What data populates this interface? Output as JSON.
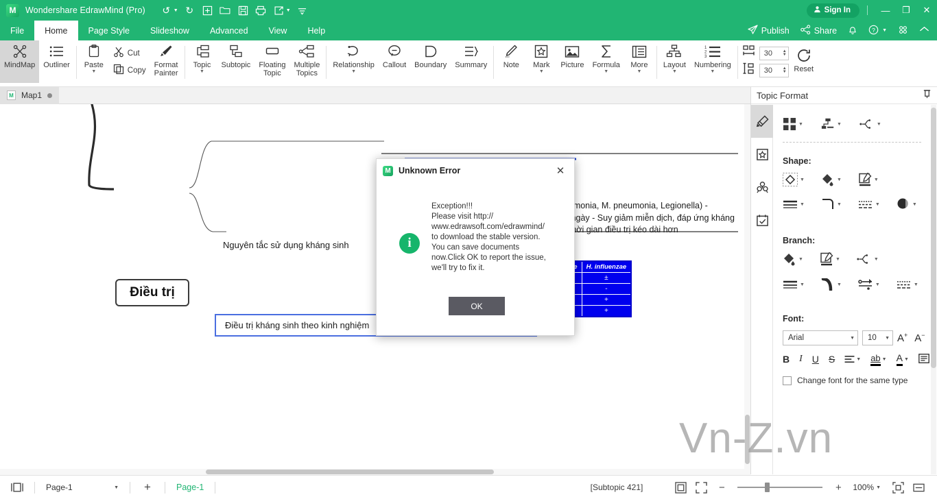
{
  "titlebar": {
    "app_name": "Wondershare EdrawMind (Pro)",
    "logo_glyph": "M",
    "quick_access": [
      {
        "name": "undo-icon",
        "glyph": "↺",
        "caret": true
      },
      {
        "name": "redo-icon",
        "glyph": "↻",
        "caret": false
      },
      {
        "name": "new-icon",
        "glyph": "⊞",
        "caret": false
      },
      {
        "name": "open-icon",
        "glyph": "🗀",
        "caret": false
      },
      {
        "name": "save-icon",
        "glyph": "🖫",
        "caret": false
      },
      {
        "name": "print-icon",
        "glyph": "⎙",
        "caret": false
      },
      {
        "name": "export-icon",
        "glyph": "⇱",
        "caret": true
      },
      {
        "name": "more-qat-icon",
        "glyph": "⩲",
        "caret": false
      }
    ],
    "sign_in": "Sign In",
    "minimize": "—",
    "restore": "❐",
    "close": "✕"
  },
  "menubar": {
    "items": [
      {
        "label": "File",
        "active": false
      },
      {
        "label": "Home",
        "active": true
      },
      {
        "label": "Page Style",
        "active": false
      },
      {
        "label": "Slideshow",
        "active": false
      },
      {
        "label": "Advanced",
        "active": false
      },
      {
        "label": "View",
        "active": false
      },
      {
        "label": "Help",
        "active": false
      }
    ],
    "right": [
      {
        "label": "Publish",
        "icon": "publish-icon"
      },
      {
        "label": "Share",
        "icon": "share-icon"
      },
      {
        "label": "",
        "icon": "bell-icon"
      },
      {
        "label": "",
        "icon": "help-icon"
      },
      {
        "label": "",
        "icon": "apps-grid-icon"
      },
      {
        "label": "",
        "icon": "collapse-ribbon-icon"
      }
    ]
  },
  "ribbon": {
    "view_group": [
      {
        "label": "MindMap",
        "icon": "mindmap-icon",
        "selected": true
      },
      {
        "label": "Outliner",
        "icon": "outliner-icon",
        "selected": false
      }
    ],
    "clipboard": {
      "paste_label": "Paste",
      "cut_label": "Cut",
      "copy_label": "Copy",
      "format_painter_label": "Format\nPainter"
    },
    "insert_group": [
      {
        "label": "Topic",
        "icon": "topic-icon",
        "dropdown": true
      },
      {
        "label": "Subtopic",
        "icon": "subtopic-icon",
        "dropdown": false
      },
      {
        "label": "Floating\nTopic",
        "icon": "floating-topic-icon",
        "dropdown": false
      },
      {
        "label": "Multiple\nTopics",
        "icon": "multiple-topics-icon",
        "dropdown": false
      }
    ],
    "relation_group": [
      {
        "label": "Relationship",
        "icon": "relationship-icon",
        "dropdown": true
      },
      {
        "label": "Callout",
        "icon": "callout-icon",
        "dropdown": false
      },
      {
        "label": "Boundary",
        "icon": "boundary-icon",
        "dropdown": false
      },
      {
        "label": "Summary",
        "icon": "summary-icon",
        "dropdown": false
      }
    ],
    "annotate_group": [
      {
        "label": "Note",
        "icon": "note-icon",
        "dropdown": false
      },
      {
        "label": "Mark",
        "icon": "mark-icon",
        "dropdown": true
      },
      {
        "label": "Picture",
        "icon": "picture-icon",
        "dropdown": false
      },
      {
        "label": "Formula",
        "icon": "formula-icon",
        "dropdown": true
      },
      {
        "label": "More",
        "icon": "more-icon",
        "dropdown": true
      }
    ],
    "layout_group": [
      {
        "label": "Layout",
        "icon": "layout-icon",
        "dropdown": true
      },
      {
        "label": "Numbering",
        "icon": "numbering-icon",
        "dropdown": true
      }
    ],
    "spacing": {
      "horizontal_value": "30",
      "vertical_value": "30",
      "reset_label": "Reset"
    }
  },
  "doc_tabs": {
    "tabs": [
      {
        "label": "Map1",
        "modified": true
      }
    ]
  },
  "canvas": {
    "root_topic": "Điều trị",
    "topic_principles": "Nguyên tắc sử dụng kháng sinh",
    "topic_selected": "Điều trị kháng sinh theo kinh nghiệm",
    "note_text": "- Tác nhân không điển hình: 10 - 14 ngày (C. pneumonia, M. pneumonia, Legionella)\n- S.pneumonia kháng thuốc hay Pseudomonas: 15 ngày\n- Suy giảm miễn dịch, đáp ứng kháng sinh không hoàn toàn, có biến chứng ngoài phổi: thời gian điều trị kéo dài hơn",
    "table": {
      "headers": [
        "S. pneumoniae",
        "H. influenzae"
      ],
      "rows": [
        [
          "±",
          "±"
        ],
        [
          "±",
          "-"
        ],
        [
          "±",
          "+"
        ],
        [
          "+",
          "+"
        ]
      ]
    },
    "watermark": "Vn-Z.vn"
  },
  "dialog": {
    "title": "Unknown Error",
    "close_glyph": "✕",
    "info_glyph": "i",
    "message": "Exception!!!\nPlease visit http://\nwww.edrawsoft.com/edrawmind/\nto download the stable version.\nYou can save documents\nnow.Click OK to report the issue,\nwe'll try to fix it.",
    "ok_label": "OK"
  },
  "right_panel": {
    "title": "Topic Format",
    "pin_icon": "pin-icon",
    "rail": [
      {
        "name": "style-fill-icon",
        "selected": true
      },
      {
        "name": "badge-icon",
        "selected": false
      },
      {
        "name": "clipart-icon",
        "selected": false
      },
      {
        "name": "task-icon",
        "selected": false
      }
    ],
    "top_icons": [
      {
        "name": "topic-style-gallery-icon"
      },
      {
        "name": "topic-layout-icon"
      },
      {
        "name": "branch-style-icon"
      }
    ],
    "shape_section_label": "Shape:",
    "shape_icons_row1": [
      {
        "name": "shape-type-icon"
      },
      {
        "name": "shape-fill-icon"
      },
      {
        "name": "shape-edit-icon"
      }
    ],
    "shape_icons_row2": [
      {
        "name": "line-weight-icon"
      },
      {
        "name": "line-corner-icon"
      },
      {
        "name": "line-dash-icon"
      },
      {
        "name": "shadow-icon"
      }
    ],
    "branch_section_label": "Branch:",
    "branch_icons_row1": [
      {
        "name": "branch-fill-icon"
      },
      {
        "name": "branch-edit-icon"
      },
      {
        "name": "branch-connector-icon"
      }
    ],
    "branch_icons_row2": [
      {
        "name": "branch-weight-icon"
      },
      {
        "name": "branch-curve-icon"
      },
      {
        "name": "branch-arrow-icon"
      },
      {
        "name": "branch-dash-icon"
      }
    ],
    "font_section_label": "Font:",
    "font_family": "Arial",
    "font_size": "10",
    "grow_font": "A",
    "shrink_font": "A",
    "format_buttons": [
      {
        "name": "bold-button",
        "glyph": "B"
      },
      {
        "name": "italic-button",
        "glyph": "I"
      },
      {
        "name": "underline-button",
        "glyph": "U"
      },
      {
        "name": "strikethrough-button",
        "glyph": "S"
      },
      {
        "name": "align-button",
        "glyph": "≡"
      },
      {
        "name": "highlight-button",
        "glyph": "ab"
      },
      {
        "name": "font-color-button",
        "glyph": "A"
      },
      {
        "name": "text-box-button",
        "glyph": "▤"
      }
    ],
    "checkbox_label": "Change font for the same type",
    "checkbox_checked": false
  },
  "status_bar": {
    "view_toggle_icon": "panel-toggle-icon",
    "page_select": "Page-1",
    "add_page_glyph": "+",
    "page_tab": "Page-1",
    "selection_info": "[Subtopic 421]",
    "fit_page_icon": "fit-page-icon",
    "full_screen_icon": "full-screen-icon",
    "zoom_out": "−",
    "zoom_in": "+",
    "zoom_level": "100%",
    "fit_icon": "fit-selection-icon",
    "fit_width_icon": "fit-width-icon"
  }
}
